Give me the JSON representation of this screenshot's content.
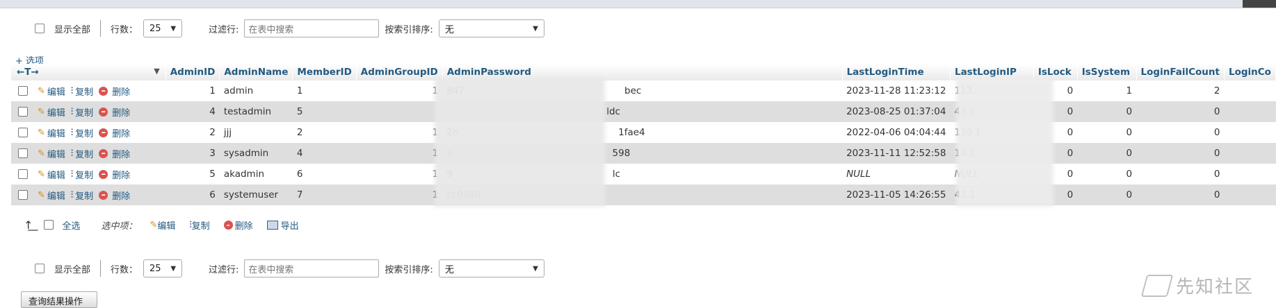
{
  "nav": {
    "show_all": "显示全部",
    "rows_label": "行数：",
    "rows_value": "25",
    "filter_label": "过滤行:",
    "filter_placeholder": "在表中搜索",
    "sort_label": "按索引排序:",
    "sort_value": "无"
  },
  "options_link": "+ 选项",
  "arrows": "←T→",
  "columns": [
    "AdminID",
    "AdminName",
    "MemberID",
    "AdminGroupID",
    "AdminPassword",
    "LastLoginTime",
    "LastLoginIP",
    "IsLock",
    "IsSystem",
    "LoginFailCount",
    "LoginCo"
  ],
  "actions": {
    "edit": "编辑",
    "copy": "复制",
    "delete": "删除"
  },
  "rows": [
    {
      "AdminID": "1",
      "AdminName": "admin",
      "MemberID": "1",
      "AdminGroupID": "1",
      "pw_start": "847",
      "pw_end": "bec",
      "LastLoginTime": "2023-11-28 11:23:12",
      "LastLoginIP": "113.",
      "IsLock": "0",
      "IsSystem": "1",
      "LoginFailCount": "2"
    },
    {
      "AdminID": "4",
      "AdminName": "testadmin",
      "MemberID": "5",
      "AdminGroupID": "",
      "pw_start": "",
      "pw_end": "ldc",
      "LastLoginTime": "2023-08-25 01:37:04",
      "LastLoginIP": "43.1",
      "IsLock": "0",
      "IsSystem": "0",
      "LoginFailCount": "0"
    },
    {
      "AdminID": "2",
      "AdminName": "jjj",
      "MemberID": "2",
      "AdminGroupID": "1",
      "pw_start": "2e",
      "pw_end": "1fae4",
      "LastLoginTime": "2022-04-06 04:04:44",
      "LastLoginIP": "130.1",
      "IsLock": "0",
      "IsSystem": "0",
      "LoginFailCount": "0"
    },
    {
      "AdminID": "3",
      "AdminName": "sysadmin",
      "MemberID": "4",
      "AdminGroupID": "1",
      "pw_start": "a",
      "pw_end": "598",
      "LastLoginTime": "2023-11-11 12:52:58",
      "LastLoginIP": "18.1",
      "IsLock": "0",
      "IsSystem": "0",
      "LoginFailCount": "0"
    },
    {
      "AdminID": "5",
      "AdminName": "akadmin",
      "MemberID": "6",
      "AdminGroupID": "1",
      "pw_start": "9",
      "pw_end": "lc",
      "LastLoginTime": "NULL",
      "LastLoginIP": "NULL",
      "IsLock": "0",
      "IsSystem": "0",
      "LoginFailCount": "0"
    },
    {
      "AdminID": "6",
      "AdminName": "systemuser",
      "MemberID": "7",
      "AdminGroupID": "1",
      "pw_start": "cc0980",
      "pw_end": "",
      "LastLoginTime": "2023-11-05 14:26:55",
      "LastLoginIP": "43.1",
      "IsLock": "0",
      "IsSystem": "0",
      "LoginFailCount": "0"
    }
  ],
  "bulk": {
    "select_all": "全选",
    "with_selected": "选中项：",
    "edit": "编辑",
    "copy": "复制",
    "delete": "删除",
    "export": "导出"
  },
  "bottom_button": "查询结果操作",
  "watermark": "先知社区"
}
